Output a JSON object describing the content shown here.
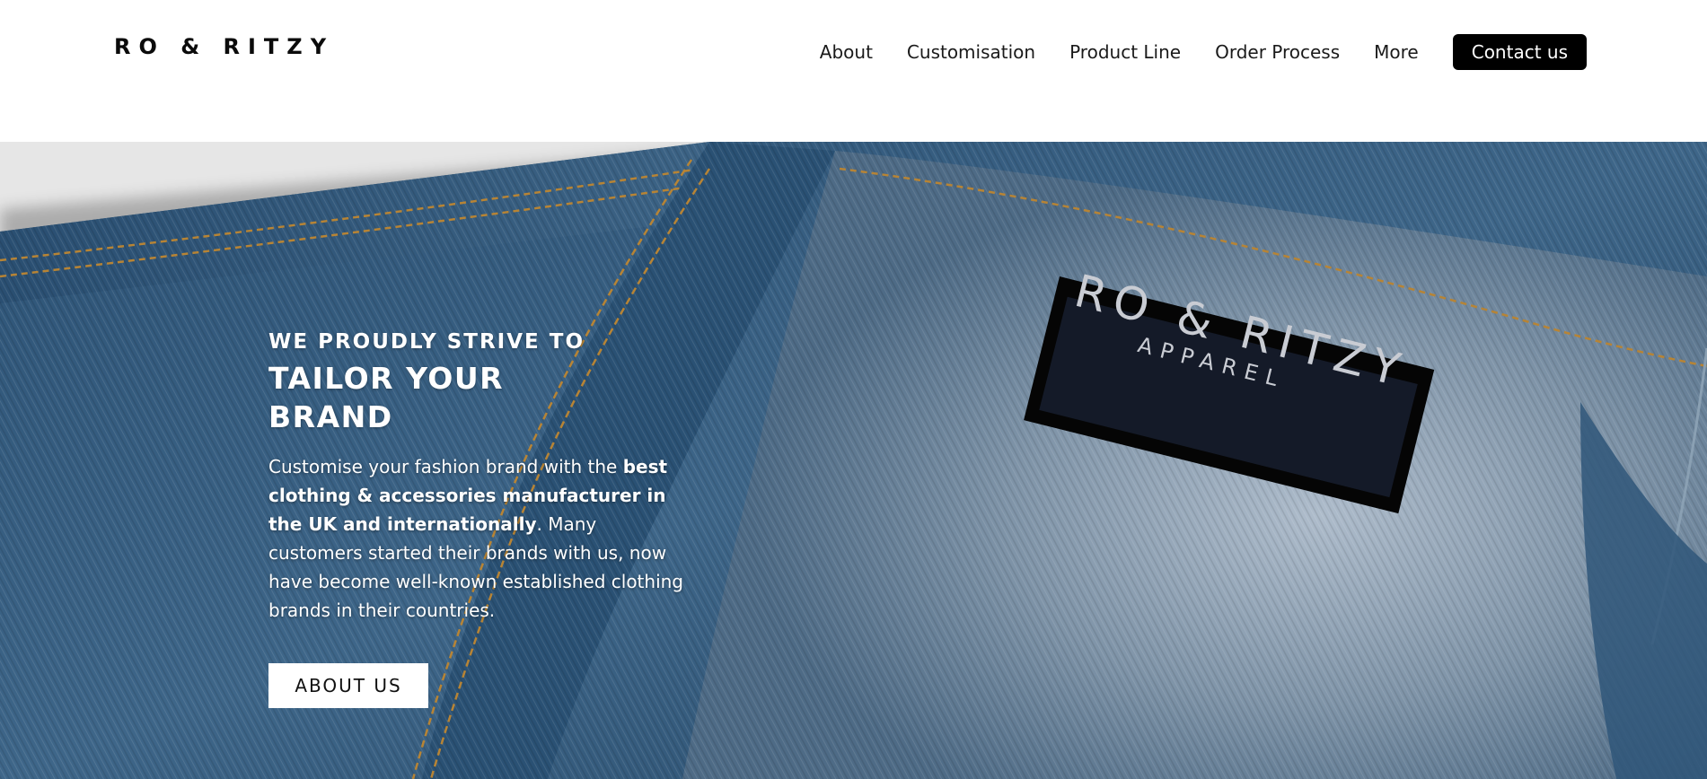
{
  "brand": {
    "name": "RO & RITZY"
  },
  "nav": {
    "items": [
      {
        "label": "About"
      },
      {
        "label": "Customisation"
      },
      {
        "label": "Product Line"
      },
      {
        "label": "Order Process"
      },
      {
        "label": "More"
      }
    ],
    "contact_label": "Contact us"
  },
  "hero": {
    "eyebrow": "WE PROUDLY STRIVE TO",
    "headline": "TAILOR YOUR BRAND",
    "body_intro": "Customise your fashion brand with the ",
    "body_bold": "best clothing & accessories manufacturer in the UK and internationally",
    "body_rest": ". Many customers started their brands with us, now have become well-known established clothing brands in their countries.",
    "cta_label": "ABOUT US",
    "label_patch": {
      "line1": "RO & RITZY",
      "line2": "APPAREL"
    }
  },
  "colors": {
    "denim_dark": "#1f3f5f",
    "denim_mid": "#3e607f",
    "denim_light": "#8ea2b4",
    "stitch": "#b78435",
    "patch": "#121724",
    "header_bg": "#ffffff",
    "button_bg": "#000000"
  }
}
